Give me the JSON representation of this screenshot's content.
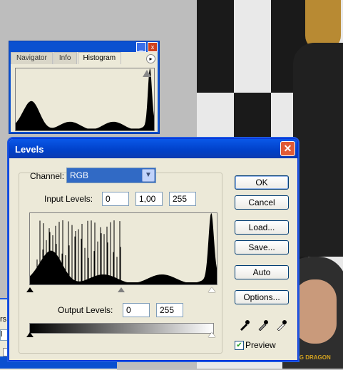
{
  "histogram_palette": {
    "tabs": [
      "Navigator",
      "Info",
      "Histogram"
    ],
    "active_tab": "Histogram",
    "minimize_label": "_",
    "close_label": "x",
    "menu_label": "▸",
    "warning_label": "!"
  },
  "dialog": {
    "title": "Levels",
    "close_label": "✕",
    "channel_label": "Channel:",
    "channel_value": "RGB",
    "input_levels_label": "Input Levels:",
    "input_black": "0",
    "input_gamma": "1,00",
    "input_white": "255",
    "output_levels_label": "Output Levels:",
    "output_black": "0",
    "output_white": "255",
    "buttons": {
      "ok": "OK",
      "cancel": "Cancel",
      "load": "Load...",
      "save": "Save...",
      "auto": "Auto",
      "options": "Options..."
    },
    "preview_label": "Preview",
    "preview_checked": true
  },
  "fragment": {
    "label_top": "rs",
    "label_mid": "l"
  },
  "photo": {
    "caption": "KING DRAGON"
  },
  "colors": {
    "titlebar": "#0a4fd6",
    "dialog_bg": "#ece9d8",
    "close_button": "#e05a36",
    "selection": "#316ac5"
  }
}
